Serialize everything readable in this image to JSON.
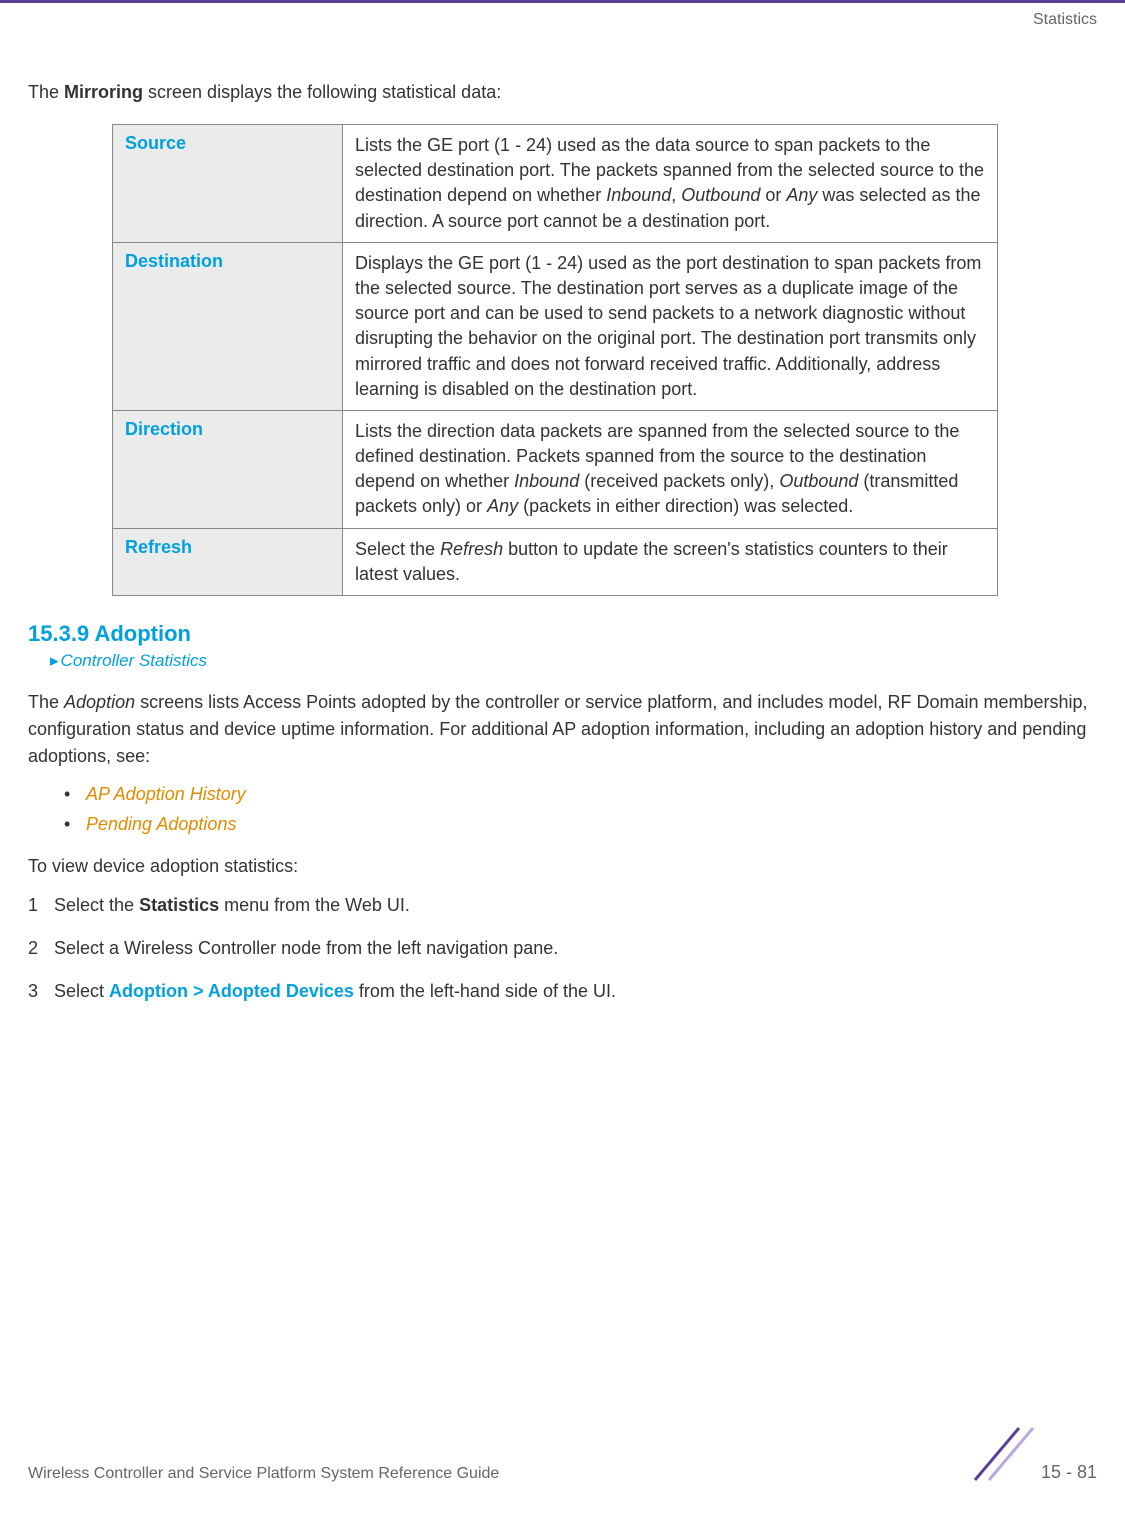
{
  "header": {
    "section": "Statistics"
  },
  "intro": {
    "prefix": "The ",
    "bold": "Mirroring",
    "suffix": " screen displays the following statistical data:"
  },
  "table": {
    "rows": [
      {
        "label": "Source",
        "text_before_italic": "Lists the GE port (1 - 24) used as the data source to span packets to the selected destination port. The packets spanned from the selected source to the destination depend on whether ",
        "italic1": "Inbound",
        "sep1": ", ",
        "italic2": "Outbound",
        "sep2": " or ",
        "italic3": "Any",
        "text_after": " was selected as the direction. A source port cannot be a destination port."
      },
      {
        "label": "Destination",
        "text": "Displays the GE port (1 - 24) used as the port destination to span packets from the selected source. The destination port serves as a duplicate image of the source port and can be used to send packets to a network diagnostic without disrupting the behavior on the original port. The destination port transmits only mirrored traffic and does not forward received traffic. Additionally, address learning is disabled on the destination port."
      },
      {
        "label": "Direction",
        "text_before": "Lists the direction data packets are spanned from the selected source to the defined destination. Packets spanned from the source to the destination depend on whether ",
        "italic1": "Inbound",
        "mid1": " (received packets only), ",
        "italic2": "Outbound",
        "mid2": " (transmitted packets only) or ",
        "italic3": "Any",
        "text_after": " (packets in either direction) was selected."
      },
      {
        "label": "Refresh",
        "text_before": "Select the ",
        "italic": "Refresh",
        "text_after": " button to update the screen's statistics counters to their latest values."
      }
    ]
  },
  "section": {
    "heading": "15.3.9 Adoption",
    "breadcrumb": "Controller Statistics"
  },
  "para1": {
    "prefix": "The ",
    "italic": "Adoption",
    "rest": " screens lists Access Points adopted by the controller or service platform, and includes model, RF Domain membership, configuration status and device uptime information. For additional AP adoption information, including an adoption history and pending adoptions, see:"
  },
  "links": {
    "link1": "AP Adoption History",
    "link2": "Pending Adoptions"
  },
  "para2": "To view device adoption statistics:",
  "steps": {
    "s1": {
      "num": "1",
      "pre": "Select the ",
      "bold": "Statistics",
      "post": " menu from the Web UI."
    },
    "s2": {
      "num": "2",
      "text": "Select a Wireless Controller node from the left navigation pane."
    },
    "s3": {
      "num": "3",
      "pre": "Select ",
      "teal": "Adoption > Adopted Devices",
      "post": " from the left-hand side of the UI."
    }
  },
  "footer": {
    "title": "Wireless Controller and Service Platform System Reference Guide",
    "page": "15 - 81"
  }
}
